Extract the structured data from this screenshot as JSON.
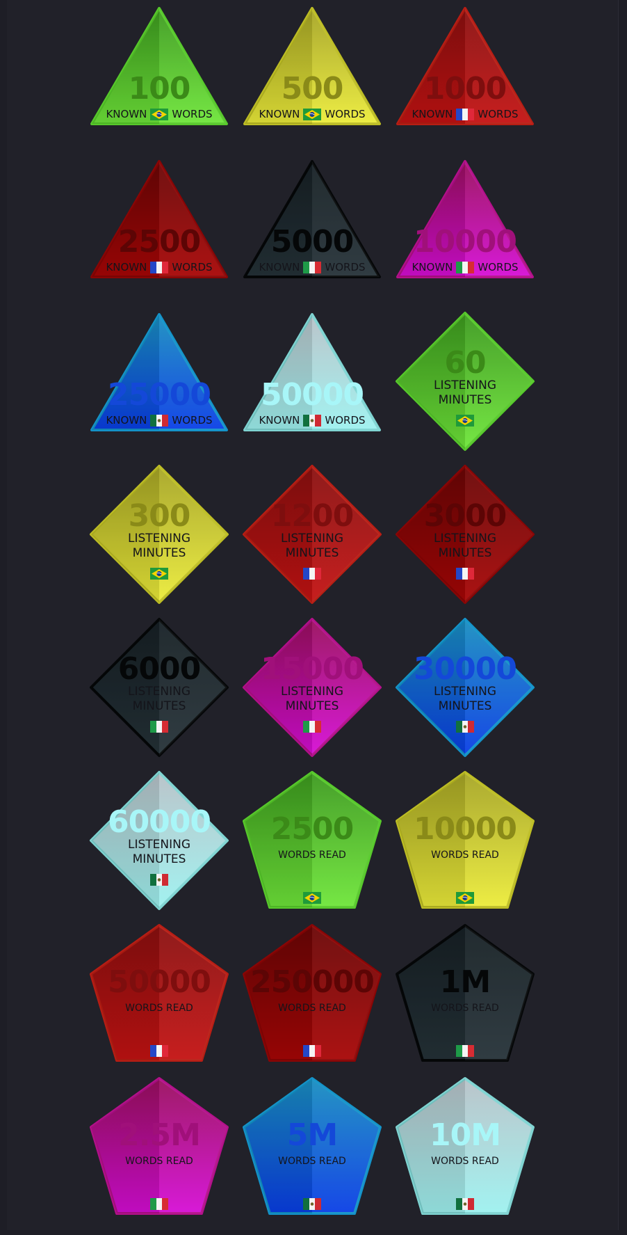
{
  "colors": {
    "green": {
      "light": "#6fe63a",
      "dark": "#3d9a1f",
      "edge": "#57c92b",
      "num": "#3b8a18"
    },
    "yellow": {
      "light": "#ecec3a",
      "dark": "#a6a526",
      "edge": "#bdbd24",
      "num": "#8a8a18"
    },
    "red": {
      "light": "#c41212",
      "dark": "#8a1010",
      "edge": "#b81d14",
      "num": "#7e0e0e"
    },
    "darkred": {
      "light": "#a80606",
      "dark": "#6a0606",
      "edge": "#8a0505",
      "num": "#5c0505"
    },
    "black": {
      "light": "#253238",
      "dark": "#172025",
      "edge": "#050708",
      "num": "#050708"
    },
    "magenta": {
      "light": "#d60ed6",
      "dark": "#9a0f5e",
      "edge": "#b3108a",
      "num": "#a0107a"
    },
    "blue": {
      "light": "#0a3ee6",
      "dark": "#1a8fc0",
      "edge": "#1493c9",
      "num": "#1448d8"
    },
    "cyan": {
      "light": "#9ef2f0",
      "dark": "#b8c2c8",
      "edge": "#7fd4d2",
      "num": "#a8f6f8"
    }
  },
  "badges": [
    {
      "shape": "triangle",
      "color": "green",
      "value": "100",
      "label": "KNOWN",
      "label2": "WORDS",
      "flag": "brazil-flag-icon"
    },
    {
      "shape": "triangle",
      "color": "yellow",
      "value": "500",
      "label": "KNOWN",
      "label2": "WORDS",
      "flag": "brazil-flag-icon"
    },
    {
      "shape": "triangle",
      "color": "red",
      "value": "1000",
      "label": "KNOWN",
      "label2": "WORDS",
      "flag": "france-flag-icon"
    },
    {
      "shape": "triangle",
      "color": "darkred",
      "value": "2500",
      "label": "KNOWN",
      "label2": "WORDS",
      "flag": "france-flag-icon"
    },
    {
      "shape": "triangle",
      "color": "black",
      "value": "5000",
      "label": "KNOWN",
      "label2": "WORDS",
      "flag": "italy-flag-icon"
    },
    {
      "shape": "triangle",
      "color": "magenta",
      "value": "10000",
      "label": "KNOWN",
      "label2": "WORDS",
      "flag": "italy-flag-icon"
    },
    {
      "shape": "triangle",
      "color": "blue",
      "value": "25000",
      "label": "KNOWN",
      "label2": "WORDS",
      "flag": "mexico-flag-icon"
    },
    {
      "shape": "triangle",
      "color": "cyan",
      "value": "50000",
      "label": "KNOWN",
      "label2": "WORDS",
      "flag": "mexico-flag-icon"
    },
    {
      "shape": "diamond",
      "color": "green",
      "value": "60",
      "label": "LISTENING",
      "label2": "MINUTES",
      "flag": "brazil-flag-icon"
    },
    {
      "shape": "diamond",
      "color": "yellow",
      "value": "300",
      "label": "LISTENING",
      "label2": "MINUTES",
      "flag": "brazil-flag-icon"
    },
    {
      "shape": "diamond",
      "color": "red",
      "value": "1200",
      "label": "LISTENING",
      "label2": "MINUTES",
      "flag": "france-flag-icon"
    },
    {
      "shape": "diamond",
      "color": "darkred",
      "value": "3000",
      "label": "LISTENING",
      "label2": "MINUTES",
      "flag": "france-flag-icon"
    },
    {
      "shape": "diamond",
      "color": "black",
      "value": "6000",
      "label": "LISTENING",
      "label2": "MINUTES",
      "flag": "italy-flag-icon"
    },
    {
      "shape": "diamond",
      "color": "magenta",
      "value": "15000",
      "label": "LISTENING",
      "label2": "MINUTES",
      "flag": "italy-flag-icon"
    },
    {
      "shape": "diamond",
      "color": "blue",
      "value": "30000",
      "label": "LISTENING",
      "label2": "MINUTES",
      "flag": "mexico-flag-icon"
    },
    {
      "shape": "diamond",
      "color": "cyan",
      "value": "60000",
      "label": "LISTENING",
      "label2": "MINUTES",
      "flag": "mexico-flag-icon"
    },
    {
      "shape": "pentagon",
      "color": "green",
      "value": "2500",
      "label": "WORDS READ",
      "label2": "",
      "flag": "brazil-flag-icon"
    },
    {
      "shape": "pentagon",
      "color": "yellow",
      "value": "10000",
      "label": "WORDS READ",
      "label2": "",
      "flag": "brazil-flag-icon"
    },
    {
      "shape": "pentagon",
      "color": "red",
      "value": "50000",
      "label": "WORDS READ",
      "label2": "",
      "flag": "france-flag-icon"
    },
    {
      "shape": "pentagon",
      "color": "darkred",
      "value": "250000",
      "label": "WORDS READ",
      "label2": "",
      "flag": "france-flag-icon"
    },
    {
      "shape": "pentagon",
      "color": "black",
      "value": "1M",
      "label": "WORDS READ",
      "label2": "",
      "flag": "italy-flag-icon"
    },
    {
      "shape": "pentagon",
      "color": "magenta",
      "value": "2.5M",
      "label": "WORDS READ",
      "label2": "",
      "flag": "italy-flag-icon"
    },
    {
      "shape": "pentagon",
      "color": "blue",
      "value": "5M",
      "label": "WORDS READ",
      "label2": "",
      "flag": "mexico-flag-icon"
    },
    {
      "shape": "pentagon",
      "color": "cyan",
      "value": "10M",
      "label": "WORDS READ",
      "label2": "",
      "flag": "mexico-flag-icon"
    }
  ]
}
